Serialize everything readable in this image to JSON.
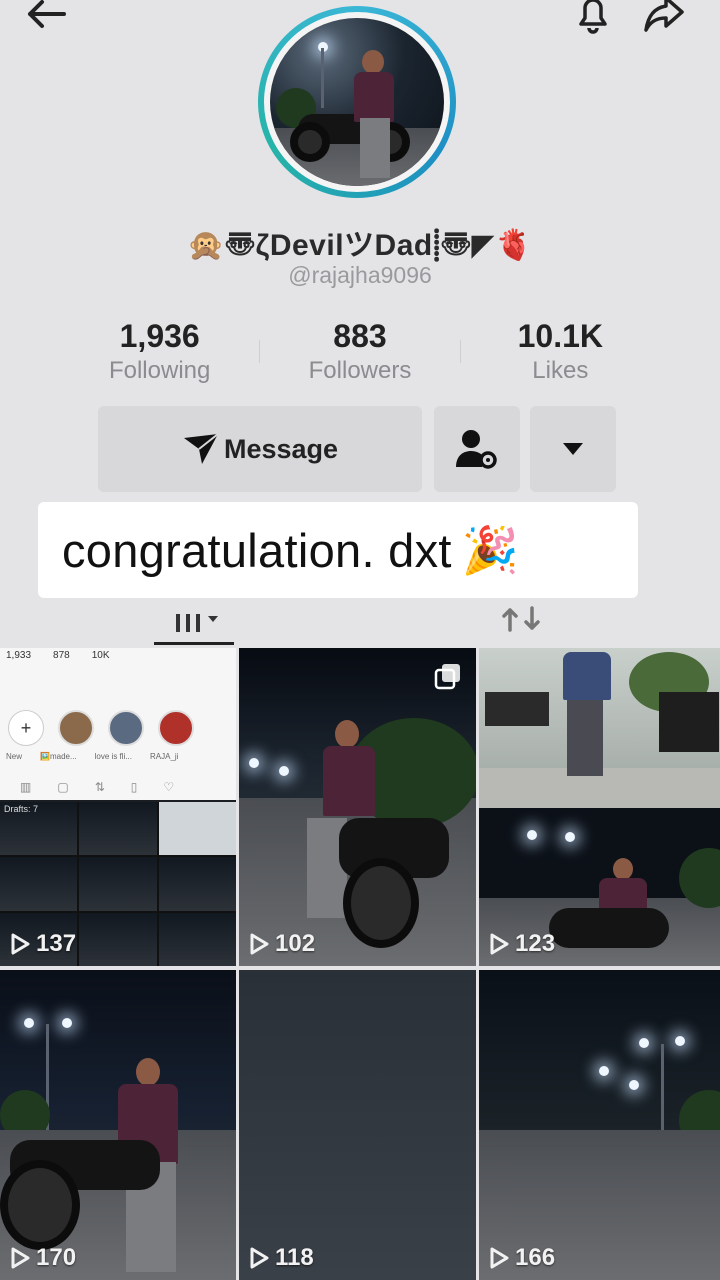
{
  "header": {
    "back_icon": "arrow-left-icon",
    "bell_icon": "bell-icon",
    "share_icon": "share-arrow-icon"
  },
  "profile": {
    "display_name": "🙊〠ζDevilツDad⸽〠◤🫀",
    "username": "@rajajha9096",
    "stats": [
      {
        "value": "1,936",
        "label": "Following"
      },
      {
        "value": "883",
        "label": "Followers"
      },
      {
        "value": "10.1K",
        "label": "Likes"
      }
    ]
  },
  "actions": {
    "message_label": "Message",
    "message_icon": "send-icon",
    "follow_options_icon": "user-settings-icon",
    "more_icon": "caret-down-icon"
  },
  "banner": {
    "text": "congratulation. dxt",
    "emoji": "🎉"
  },
  "tabs": {
    "videos_icon": "grid-filter-icon",
    "repost_icon": "repost-icon"
  },
  "mini_screenshot": {
    "stats": [
      "1,933",
      "878",
      "10K"
    ],
    "labels": [
      "New",
      "🖼️made...",
      "love is fli...",
      "RAJA_ji"
    ],
    "drafts": "Drafts: 7"
  },
  "videos": [
    {
      "views": "137"
    },
    {
      "views": "102"
    },
    {
      "views": "123"
    },
    {
      "views": "170"
    },
    {
      "views": "118"
    },
    {
      "views": "166"
    }
  ],
  "colors": {
    "background": "#e4e4e6",
    "avatar_ring": "#3bb7d6",
    "banner_bg": "#ffffff"
  }
}
